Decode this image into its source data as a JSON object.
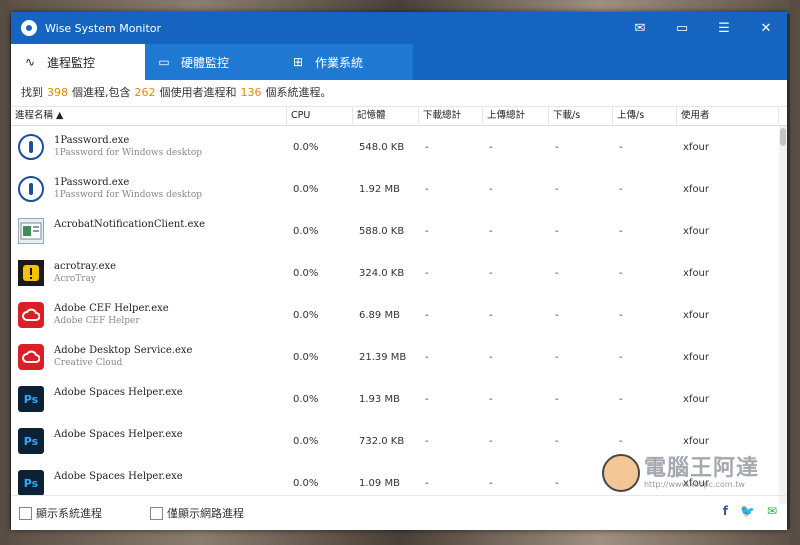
{
  "app": {
    "title": "Wise System Monitor",
    "accent": "#1565c0",
    "title_controls": [
      {
        "icon": "mail-icon",
        "glyph": "✉"
      },
      {
        "icon": "message-icon",
        "glyph": "▭"
      },
      {
        "icon": "menu-icon",
        "glyph": "☰"
      },
      {
        "icon": "close-icon",
        "glyph": "✕"
      }
    ]
  },
  "tabs": [
    {
      "label": "進程監控",
      "icon": "process-monitor-icon",
      "active": true
    },
    {
      "label": "硬體監控",
      "icon": "hardware-monitor-icon",
      "active": false
    },
    {
      "label": "作業系統",
      "icon": "windows-icon",
      "active": false
    }
  ],
  "summary": {
    "prefix": "找到",
    "total": "398",
    "mid1": "個進程,包含",
    "user": "262",
    "mid2": "個使用者進程和",
    "system": "136",
    "suffix": "個系統進程。"
  },
  "columns": [
    "進程名稱 ▲",
    "CPU",
    "記憶體",
    "下載總計",
    "上傳總計",
    "下載/s",
    "上傳/s",
    "使用者"
  ],
  "processes": [
    {
      "name": "1Password.exe",
      "desc": "1Password for Windows desktop",
      "icon": "1password-icon",
      "cpu": "0.0%",
      "mem": "548.0 KB",
      "dl_total": "-",
      "ul_total": "-",
      "dl_rate": "-",
      "ul_rate": "-",
      "user": "xfour"
    },
    {
      "name": "1Password.exe",
      "desc": "1Password for Windows desktop",
      "icon": "1password-icon",
      "cpu": "0.0%",
      "mem": "1.92 MB",
      "dl_total": "-",
      "ul_total": "-",
      "dl_rate": "-",
      "ul_rate": "-",
      "user": "xfour"
    },
    {
      "name": "AcrobatNotificationClient.exe",
      "desc": "",
      "icon": "acrobat-notification-icon",
      "cpu": "0.0%",
      "mem": "588.0 KB",
      "dl_total": "-",
      "ul_total": "-",
      "dl_rate": "-",
      "ul_rate": "-",
      "user": "xfour"
    },
    {
      "name": "acrotray.exe",
      "desc": "AcroTray",
      "icon": "acrotray-icon",
      "cpu": "0.0%",
      "mem": "324.0 KB",
      "dl_total": "-",
      "ul_total": "-",
      "dl_rate": "-",
      "ul_rate": "-",
      "user": "xfour"
    },
    {
      "name": "Adobe CEF Helper.exe",
      "desc": "Adobe CEF Helper",
      "icon": "creative-cloud-icon",
      "cpu": "0.0%",
      "mem": "6.89 MB",
      "dl_total": "-",
      "ul_total": "-",
      "dl_rate": "-",
      "ul_rate": "-",
      "user": "xfour"
    },
    {
      "name": "Adobe Desktop Service.exe",
      "desc": "Creative Cloud",
      "icon": "creative-cloud-icon",
      "cpu": "0.0%",
      "mem": "21.39 MB",
      "dl_total": "-",
      "ul_total": "-",
      "dl_rate": "-",
      "ul_rate": "-",
      "user": "xfour"
    },
    {
      "name": "Adobe Spaces Helper.exe",
      "desc": "",
      "icon": "photoshop-icon",
      "cpu": "0.0%",
      "mem": "1.93 MB",
      "dl_total": "-",
      "ul_total": "-",
      "dl_rate": "-",
      "ul_rate": "-",
      "user": "xfour"
    },
    {
      "name": "Adobe Spaces Helper.exe",
      "desc": "",
      "icon": "photoshop-icon",
      "cpu": "0.0%",
      "mem": "732.0 KB",
      "dl_total": "-",
      "ul_total": "-",
      "dl_rate": "-",
      "ul_rate": "-",
      "user": "xfour"
    },
    {
      "name": "Adobe Spaces Helper.exe",
      "desc": "",
      "icon": "photoshop-icon",
      "cpu": "0.0%",
      "mem": "1.09 MB",
      "dl_total": "-",
      "ul_total": "-",
      "dl_rate": "-",
      "ul_rate": "-",
      "user": "xfour"
    }
  ],
  "footer": {
    "show_system": "顯示系統進程",
    "show_network": "僅顯示網路進程",
    "social": [
      {
        "icon": "facebook-icon",
        "glyph": "f",
        "color": "#3b5998"
      },
      {
        "icon": "twitter-icon",
        "glyph": "🐦",
        "color": "#1da1f2"
      },
      {
        "icon": "email-share-icon",
        "glyph": "✉",
        "color": "#2bb24c"
      }
    ]
  },
  "watermark": {
    "text": "電腦王阿達",
    "url": "http://www.kocpc.com.tw"
  }
}
